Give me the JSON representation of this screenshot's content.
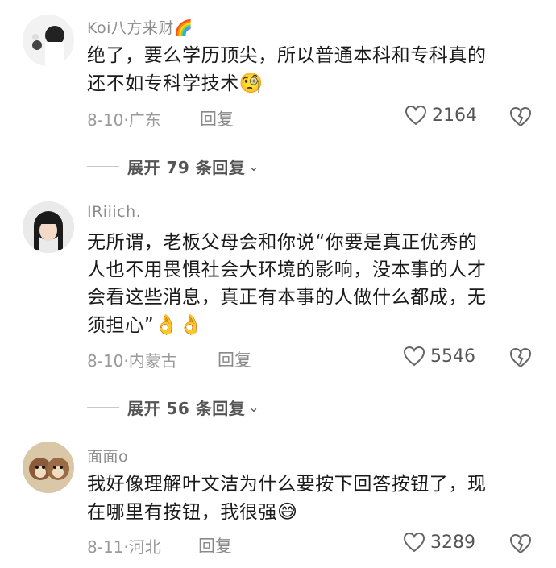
{
  "comments": [
    {
      "username": "Koi八方来财",
      "username_emoji": "🌈",
      "text": "绝了，要么学历顶尖，所以普通本科和专科真的\n还不如专科学技术",
      "text_emoji": "🧐",
      "date": "8-10·广东",
      "reply_label": "回复",
      "likes": "2164",
      "expand_label": "展开 79 条回复"
    },
    {
      "username": "IRiiich.",
      "text": "无所谓，老板父母会和你说“你要是真正优秀的\n人也不用畏惧社会大环境的影响，没本事的人才\n会看这些消息，真正有本事的人做什么都成，无\n须担心”",
      "text_emoji": "👌👌",
      "date": "8-10·内蒙古",
      "reply_label": "回复",
      "likes": "5546",
      "expand_label": "展开 56 条回复"
    },
    {
      "username": "面面o",
      "text": "我好像理解叶文洁为什么要按下回答按钮了，现\n在哪里有按钮，我很强",
      "text_emoji": "😅",
      "date": "8-11·河北",
      "reply_label": "回复",
      "likes": "3289"
    }
  ]
}
